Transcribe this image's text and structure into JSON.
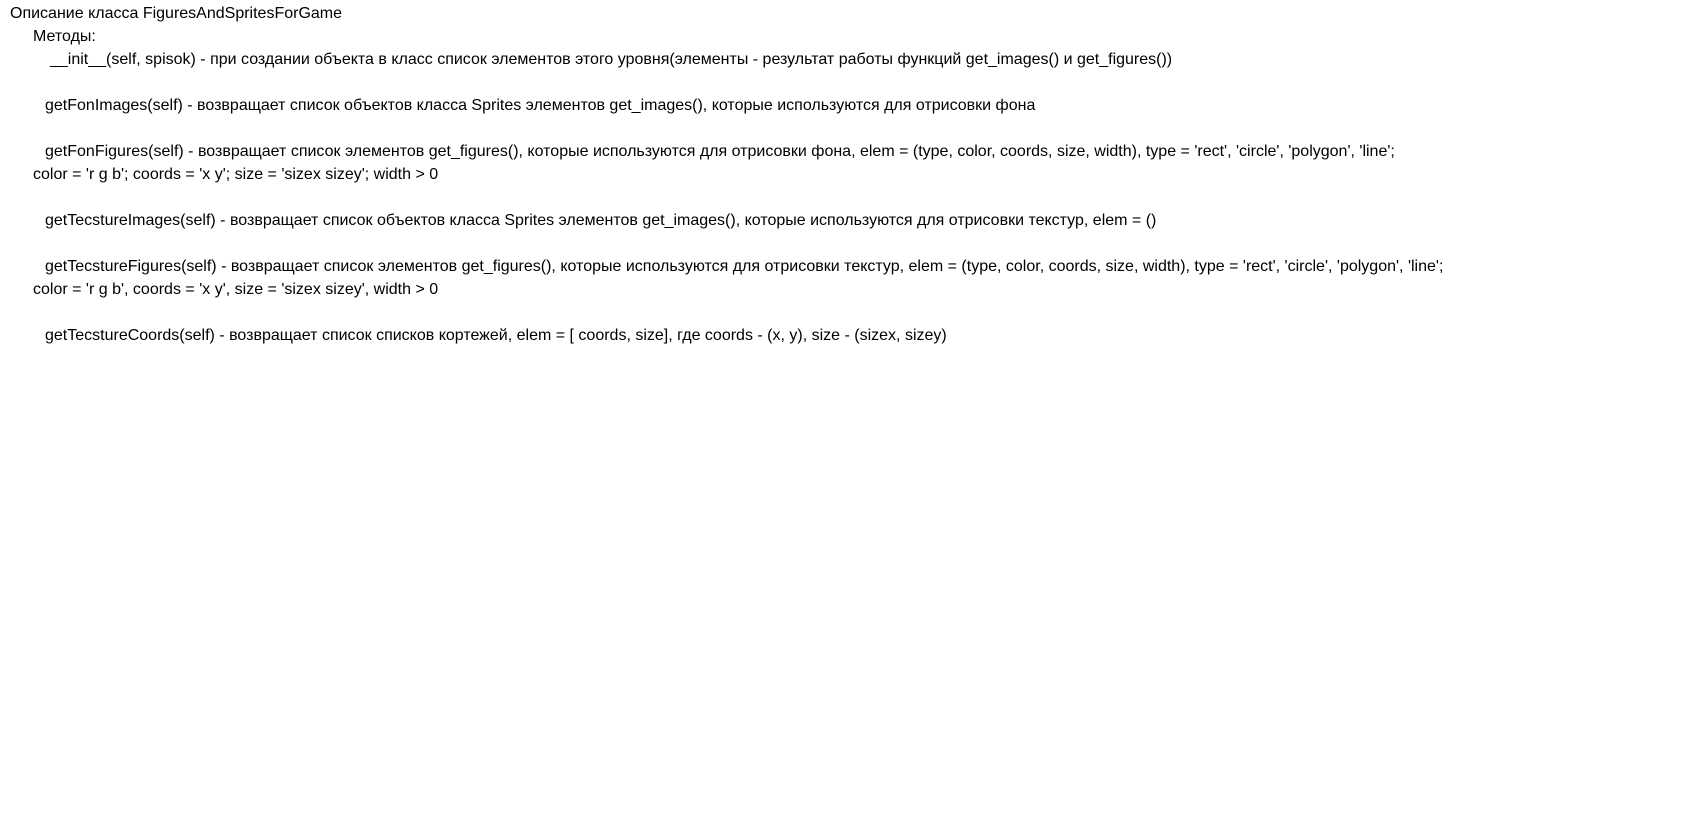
{
  "document": {
    "title": "Описание класса FiguresAndSpritesForGame",
    "section_label": "Методы:",
    "methods": [
      {
        "line1": "__init__(self, spisok) - при создании объекта в класс список элементов этого уровня(элементы - результат работы функций get_images() и get_figures())",
        "line2": ""
      },
      {
        "line1": "getFonImages(self) - возвращает список объектов класса Sprites элементов get_images(), которые используются для отрисовки фона",
        "line2": ""
      },
      {
        "line1": "getFonFigures(self) - возвращает список элементов get_figures(), которые используются для отрисовки фона, elem = (type, color, coords, size, width), type = 'rect', 'circle', 'polygon', 'line';",
        "line2": "color = 'r g b'; coords = 'x y'; size = 'sizex sizey'; width > 0"
      },
      {
        "line1": "getTecstureImages(self) - возвращает список объектов класса Sprites элементов get_images(), которые используются для отрисовки текстур, elem = ()",
        "line2": ""
      },
      {
        "line1": "getTecstureFigures(self) - возвращает список элементов get_figures(), которые используются для отрисовки текстур, elem = (type, color, coords, size, width), type = 'rect', 'circle', 'polygon', 'line';",
        "line2": "color = 'r g b', coords = 'x y', size = 'sizex sizey', width > 0"
      },
      {
        "line1": "getTecstureCoords(self) - возвращает список списков кортежей, elem = [ coords, size], где coords - (x, y), size - (sizex, sizey)",
        "line2": ""
      }
    ]
  }
}
